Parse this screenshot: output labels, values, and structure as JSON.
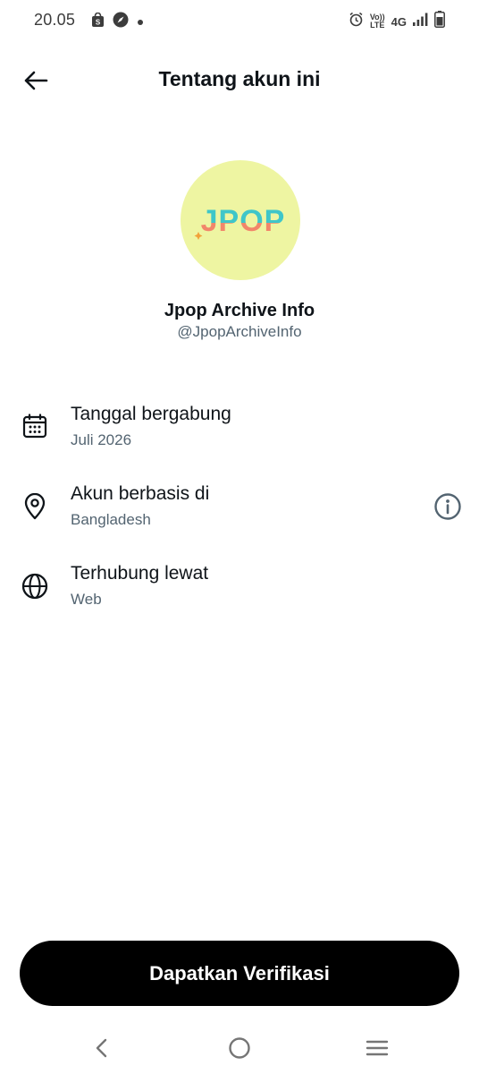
{
  "status_bar": {
    "time": "20.05",
    "volte_top": "Vo))",
    "volte_bottom": "LTE",
    "network": "4G",
    "icons": [
      "shopping-bag-icon",
      "compass-icon",
      "notification-dot-icon",
      "alarm-icon",
      "signal-icon",
      "battery-icon"
    ]
  },
  "header": {
    "title": "Tentang akun ini",
    "back_icon": "arrow-left-icon"
  },
  "profile": {
    "avatar_text": "JPOP",
    "avatar_bg": "#eef5a2",
    "display_name": "Jpop Archive Info",
    "handle": "@JpopArchiveInfo"
  },
  "info_rows": [
    {
      "icon": "calendar-icon",
      "label": "Tanggal bergabung",
      "value": "Juli 2026"
    },
    {
      "icon": "location-pin-icon",
      "label": "Akun berbasis di",
      "value": "Bangladesh",
      "action_icon": "info-icon"
    },
    {
      "icon": "globe-icon",
      "label": "Terhubung lewat",
      "value": "Web"
    }
  ],
  "verify_button": {
    "label": "Dapatkan Verifikasi"
  },
  "nav_bar": {
    "icons": [
      "nav-back-icon",
      "nav-home-icon",
      "nav-recents-icon"
    ]
  },
  "colors": {
    "primary_text": "#0f1419",
    "secondary_text": "#536471",
    "button_bg": "#000000",
    "button_text": "#ffffff"
  }
}
